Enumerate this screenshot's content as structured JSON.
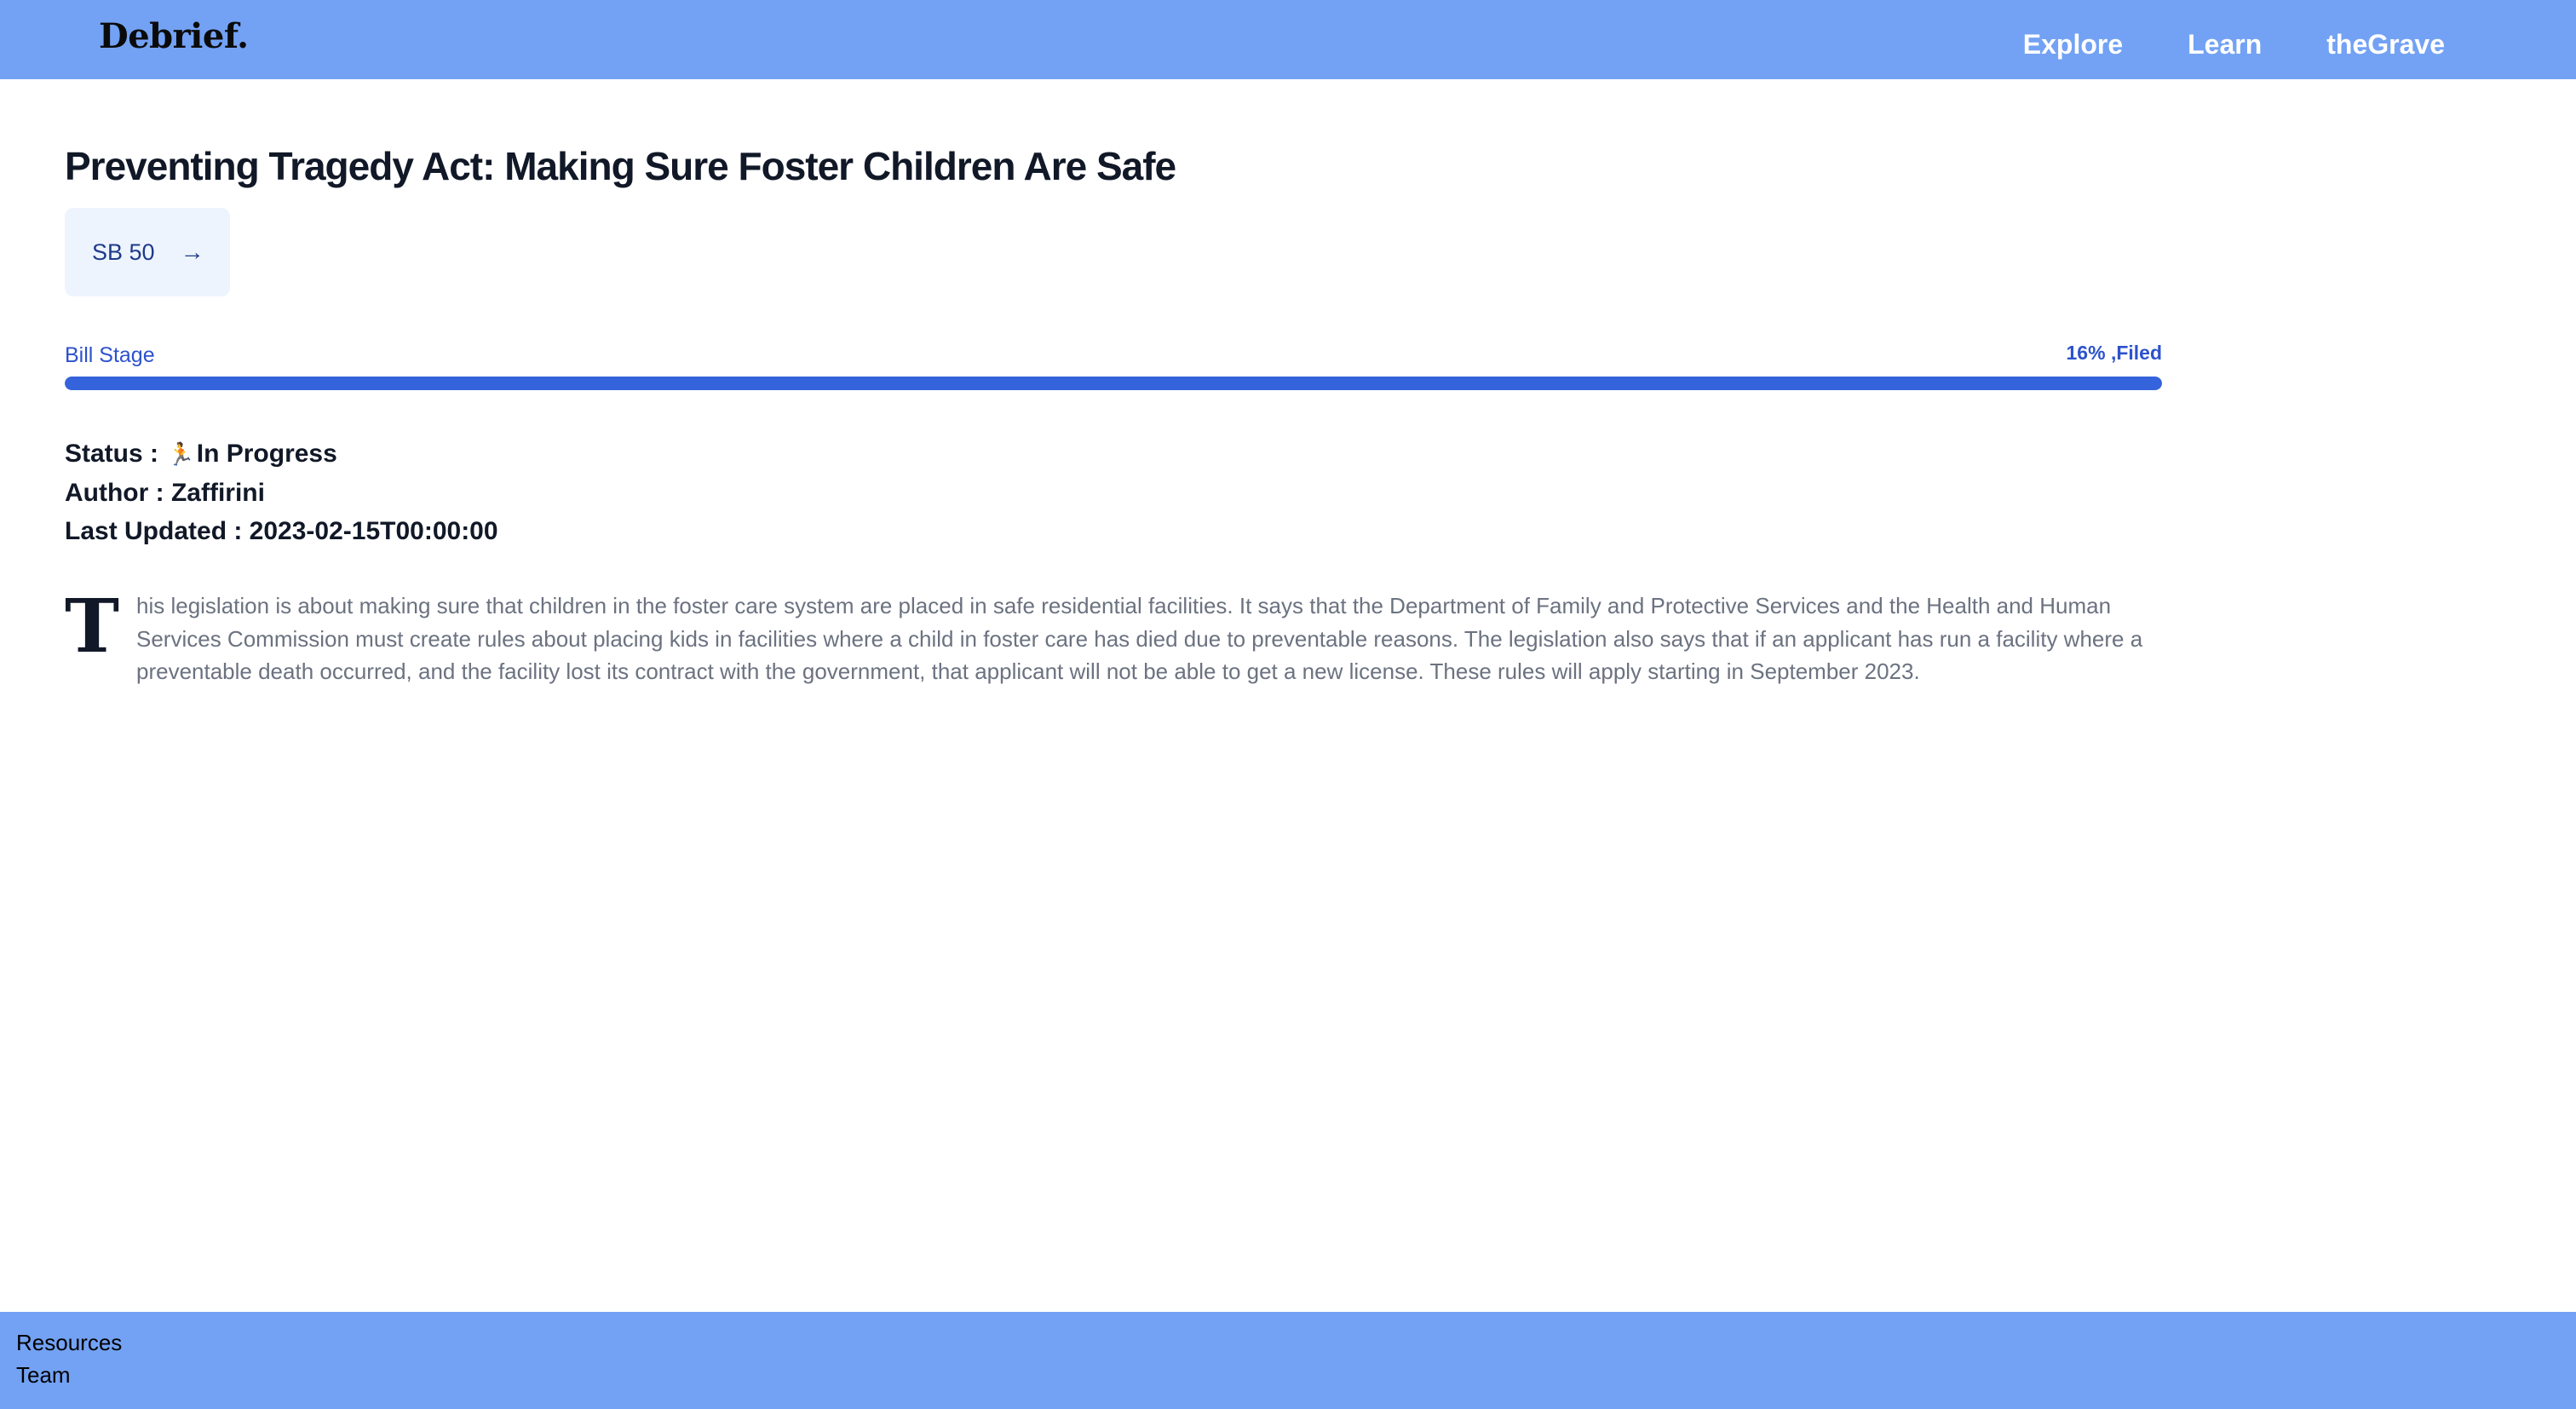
{
  "header": {
    "logo": "Debrief.",
    "nav": [
      "Explore",
      "Learn",
      "theGrave"
    ]
  },
  "bill": {
    "title": "Preventing Tragedy Act: Making Sure Foster Children Are Safe",
    "id_label": "SB 50",
    "arrow": "→"
  },
  "stage": {
    "label": "Bill Stage",
    "percent_text": "16% ,Filed",
    "progress_fraction": 1.0
  },
  "meta": {
    "status_label": "Status : ",
    "status_icon": "🏃",
    "status_value": "In Progress",
    "author_text": "Author : Zaffirini",
    "updated_text": "Last Updated : 2023-02-15T00:00:00"
  },
  "description": {
    "dropcap": "T",
    "text": "his legislation is about making sure that children in the foster care system are placed in safe residential facilities. It says that the Department of Family and Protective Services and the Health and Human Services Commission must create rules about placing kids in facilities where a child in foster care has died due to preventable reasons. The legislation also says that if an applicant has run a facility where a preventable death occurred, and the facility lost its contract with the government, that applicant will not be able to get a new license. These rules will apply starting in September 2023."
  },
  "footer": {
    "links": [
      "Resources",
      "Team"
    ]
  },
  "colors": {
    "header_bg": "#73a2f4",
    "accent": "#3463db",
    "button_bg": "#eef4fe"
  }
}
